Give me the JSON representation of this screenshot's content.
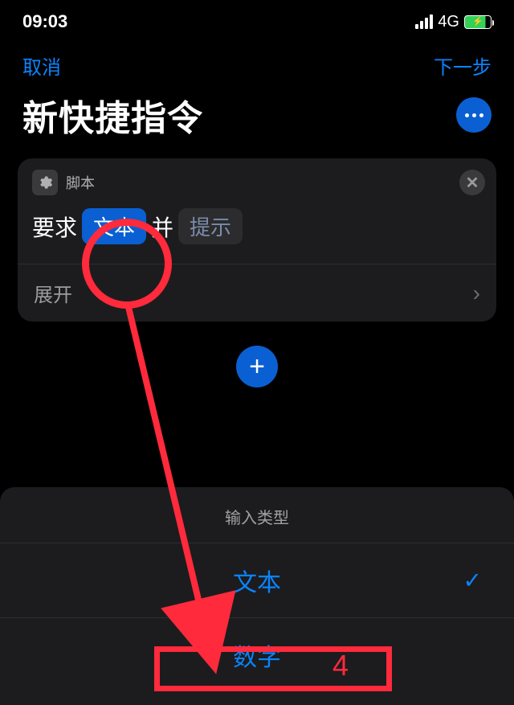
{
  "status": {
    "time": "09:03",
    "network": "4G"
  },
  "nav": {
    "cancel": "取消",
    "next": "下一步"
  },
  "page": {
    "title": "新快捷指令"
  },
  "card": {
    "scriptLabel": "脚本",
    "action": {
      "prefix": "要求",
      "option": "文本",
      "mid": "并",
      "hint": "提示"
    },
    "expand": "展开"
  },
  "picker": {
    "header": "输入类型",
    "options": [
      {
        "label": "文本",
        "selected": true
      },
      {
        "label": "数字",
        "selected": false
      }
    ]
  },
  "annotation": {
    "marker": "4"
  }
}
